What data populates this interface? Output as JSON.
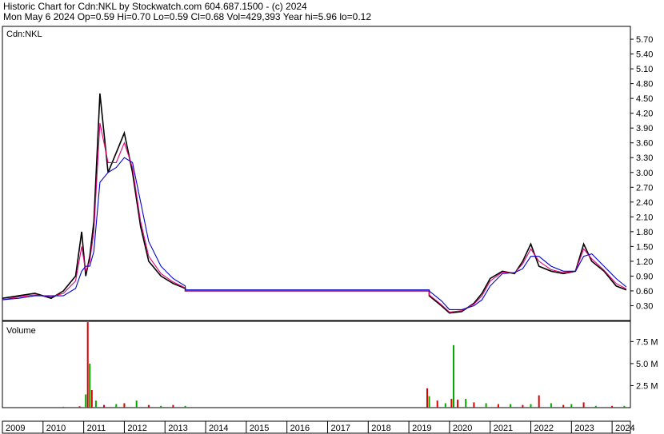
{
  "header": {
    "line1": "Historic Chart for Cdn:NKL by Stockwatch.com 604.687.1500 - (c) 2024",
    "line2": "Mon May  6 2024   Op=0.59  Hi=0.70  Lo=0.59  Cl=0.68  Vol=429,393  Year hi=5.96  lo=0.12"
  },
  "chart_data": [
    {
      "type": "line",
      "title": "Cdn:NKL",
      "y_ticks": [
        "0.30",
        "0.60",
        "0.90",
        "1.20",
        "1.50",
        "1.80",
        "2.10",
        "2.40",
        "2.70",
        "3.00",
        "3.30",
        "3.60",
        "3.90",
        "4.20",
        "4.50",
        "4.80",
        "5.10",
        "5.40",
        "5.70"
      ],
      "ylim": [
        0.0,
        5.96
      ],
      "x": [
        2009.0,
        2009.4,
        2009.8,
        2010.2,
        2010.5,
        2010.8,
        2010.95,
        2011.05,
        2011.15,
        2011.25,
        2011.4,
        2011.6,
        2011.8,
        2012.0,
        2012.2,
        2012.4,
        2012.6,
        2012.9,
        2013.2,
        2013.5,
        2013.5,
        2019.5,
        2019.5,
        2019.8,
        2020.0,
        2020.3,
        2020.6,
        2020.8,
        2021.0,
        2021.3,
        2021.6,
        2021.8,
        2022.0,
        2022.2,
        2022.5,
        2022.8,
        2023.1,
        2023.3,
        2023.5,
        2023.8,
        2024.1,
        2024.35
      ],
      "series": [
        {
          "values": [
            0.45,
            0.5,
            0.55,
            0.45,
            0.6,
            0.9,
            1.8,
            0.9,
            1.3,
            2.0,
            4.6,
            3.0,
            3.4,
            3.8,
            3.0,
            1.9,
            1.2,
            0.9,
            0.75,
            0.65,
            0.6,
            0.6,
            0.5,
            0.3,
            0.15,
            0.18,
            0.35,
            0.55,
            0.85,
            1.0,
            0.95,
            1.2,
            1.55,
            1.1,
            1.0,
            0.95,
            1.0,
            1.55,
            1.2,
            1.0,
            0.7,
            0.62
          ],
          "color": "#000000"
        },
        {
          "values": [
            0.42,
            0.48,
            0.52,
            0.48,
            0.55,
            0.8,
            1.5,
            1.0,
            1.2,
            1.8,
            4.0,
            3.2,
            3.2,
            3.6,
            3.1,
            2.0,
            1.3,
            0.95,
            0.78,
            0.66,
            0.6,
            0.6,
            0.52,
            0.32,
            0.17,
            0.2,
            0.33,
            0.5,
            0.8,
            0.98,
            0.96,
            1.15,
            1.45,
            1.2,
            1.03,
            0.97,
            1.0,
            1.45,
            1.25,
            1.02,
            0.75,
            0.64
          ],
          "color": "#e0007a"
        },
        {
          "values": [
            0.42,
            0.45,
            0.5,
            0.5,
            0.5,
            0.65,
            1.0,
            1.1,
            1.1,
            1.4,
            2.8,
            3.0,
            3.1,
            3.3,
            3.2,
            2.4,
            1.6,
            1.1,
            0.85,
            0.7,
            0.62,
            0.62,
            0.6,
            0.4,
            0.22,
            0.22,
            0.3,
            0.42,
            0.7,
            0.95,
            0.97,
            1.05,
            1.3,
            1.3,
            1.1,
            1.0,
            1.0,
            1.3,
            1.35,
            1.1,
            0.85,
            0.68
          ],
          "color": "#0000cc"
        }
      ]
    },
    {
      "type": "bar",
      "title": "Volume",
      "y_ticks": [
        "2.5 M",
        "5.0 M",
        "7.5 M"
      ],
      "ylim": [
        0,
        9.8
      ],
      "x": [
        2010.5,
        2010.9,
        2011.05,
        2011.1,
        2011.15,
        2011.2,
        2011.3,
        2011.5,
        2011.8,
        2012.0,
        2012.3,
        2012.6,
        2012.9,
        2013.2,
        2013.5,
        2019.45,
        2019.5,
        2019.7,
        2019.9,
        2020.05,
        2020.1,
        2020.2,
        2020.4,
        2020.6,
        2020.9,
        2021.2,
        2021.5,
        2021.8,
        2022.0,
        2022.2,
        2022.5,
        2022.8,
        2023.0,
        2023.3,
        2023.6,
        2024.0,
        2024.3
      ],
      "values": [
        0.1,
        0.15,
        1.5,
        9.7,
        5.0,
        2.0,
        0.8,
        0.3,
        0.4,
        0.5,
        0.8,
        0.3,
        0.2,
        0.3,
        0.2,
        2.2,
        1.3,
        0.8,
        0.5,
        1.0,
        7.1,
        0.9,
        1.0,
        0.6,
        0.5,
        0.4,
        0.4,
        0.3,
        0.4,
        1.4,
        0.5,
        0.3,
        0.4,
        0.6,
        0.2,
        0.2,
        0.2
      ],
      "colors": [
        "green",
        "red"
      ]
    }
  ],
  "x_ticks": [
    "2009",
    "2010",
    "2011",
    "2012",
    "2013",
    "2014",
    "2015",
    "2016",
    "2017",
    "2018",
    "2019",
    "2020",
    "2021",
    "2022",
    "2023",
    "2024"
  ]
}
